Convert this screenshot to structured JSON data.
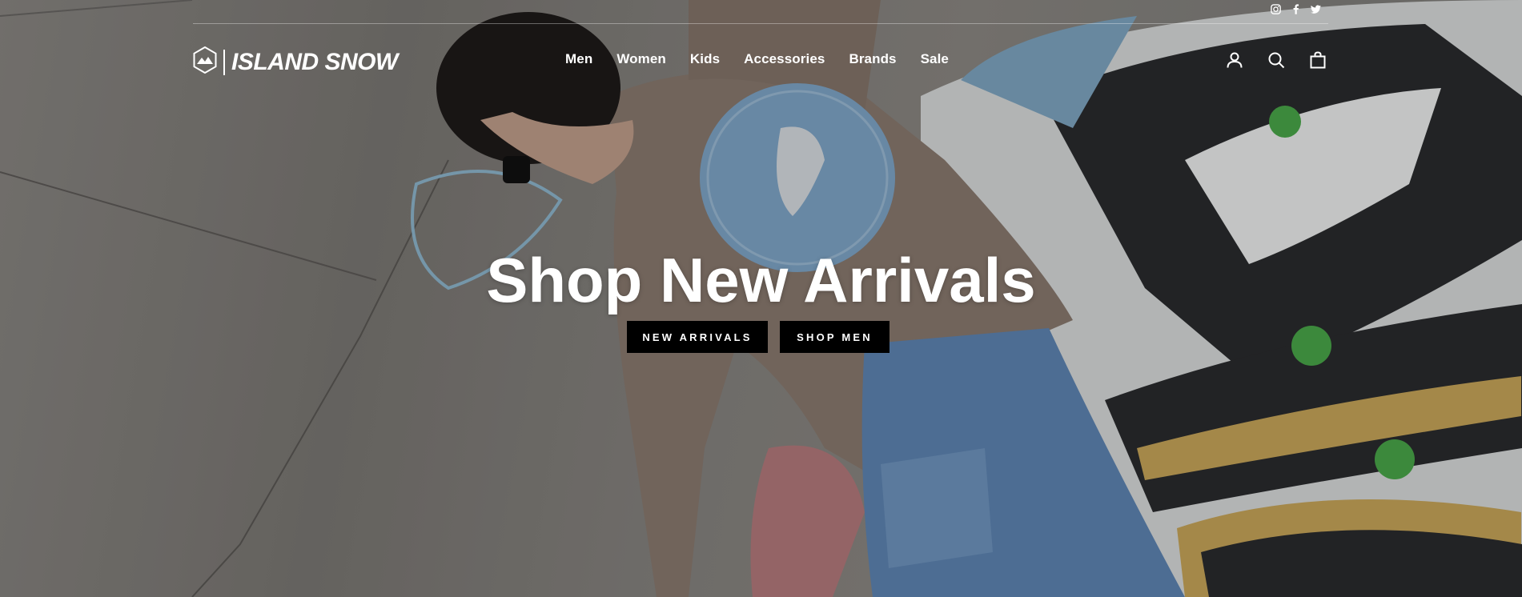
{
  "brand": {
    "name": "ISLAND SNOW",
    "logo_icon": "mountain-hexagon-icon"
  },
  "social": [
    {
      "name": "instagram-icon"
    },
    {
      "name": "facebook-icon"
    },
    {
      "name": "twitter-icon"
    }
  ],
  "nav": {
    "items": [
      "Men",
      "Women",
      "Kids",
      "Accessories",
      "Brands",
      "Sale"
    ]
  },
  "tools": [
    {
      "name": "account-icon"
    },
    {
      "name": "search-icon"
    },
    {
      "name": "cart-icon"
    }
  ],
  "hero": {
    "headline": "Shop New Arrivals",
    "primary_cta": "NEW ARRIVALS",
    "secondary_cta": "SHOP MEN"
  },
  "colors": {
    "text": "#ffffff",
    "button_bg": "#000000"
  }
}
